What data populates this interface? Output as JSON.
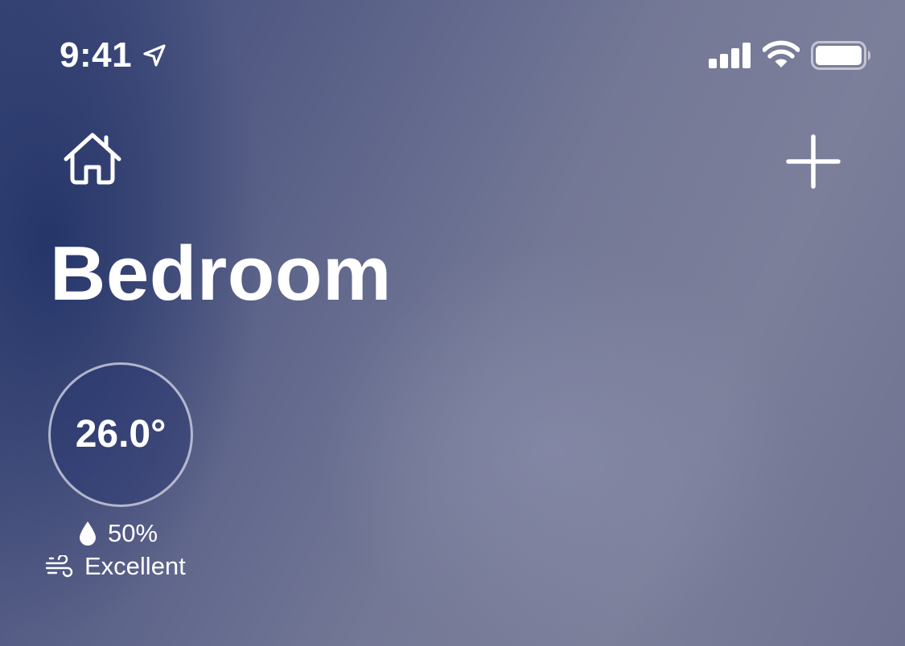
{
  "status_bar": {
    "time": "9:41",
    "icons": [
      "location-arrow-icon",
      "cellular-signal-icon",
      "wifi-icon",
      "battery-icon"
    ]
  },
  "header": {
    "left_icon": "house-icon",
    "right_icon": "plus-icon"
  },
  "room": {
    "title": "Bedroom"
  },
  "climate": {
    "temperature": "26.0°",
    "humidity": "50%",
    "humidity_icon": "water-drop-icon",
    "air_quality": "Excellent",
    "air_quality_icon": "wind-icon"
  },
  "colors": {
    "text": "#ffffff",
    "background_dark": "#2c3a6e",
    "background_light": "#7f829e"
  }
}
